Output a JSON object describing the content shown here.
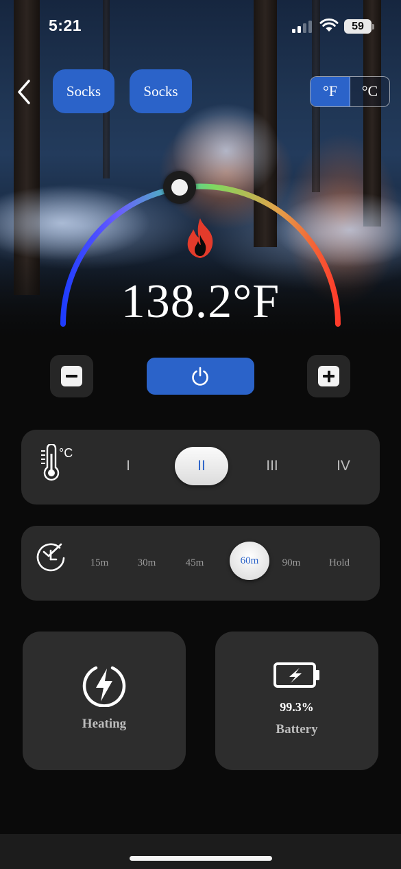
{
  "status_bar": {
    "time": "5:21",
    "battery_level": "59"
  },
  "header": {
    "tags": [
      "Socks",
      "Socks"
    ],
    "units": {
      "fahrenheit": "°F",
      "celsius": "°C",
      "selected": "fahrenheit"
    }
  },
  "gauge": {
    "temperature": "138.2°F",
    "arc_colors": [
      "#1e3cff",
      "#6a5cff",
      "#47c8b0",
      "#7fd960",
      "#e2a24a",
      "#ff3a2a"
    ]
  },
  "controls": {
    "decrease_icon": "minus-icon",
    "power_icon": "power-icon",
    "increase_icon": "plus-icon"
  },
  "heat_level": {
    "unit_label": "°C",
    "options": [
      "I",
      "II",
      "III",
      "IV"
    ],
    "selected_index": 1
  },
  "timer": {
    "options": [
      "15m",
      "30m",
      "45m",
      "60m",
      "90m",
      "Hold"
    ],
    "selected_index": 3
  },
  "cards": {
    "heating": {
      "label": "Heating",
      "icon": "lightning-bolt-icon"
    },
    "battery": {
      "value": "99.3%",
      "label": "Battery",
      "icon": "battery-charging-icon"
    }
  },
  "colors": {
    "accent": "#2b63c9",
    "panel": "#2a2a2a",
    "background": "#0a0a0a"
  }
}
